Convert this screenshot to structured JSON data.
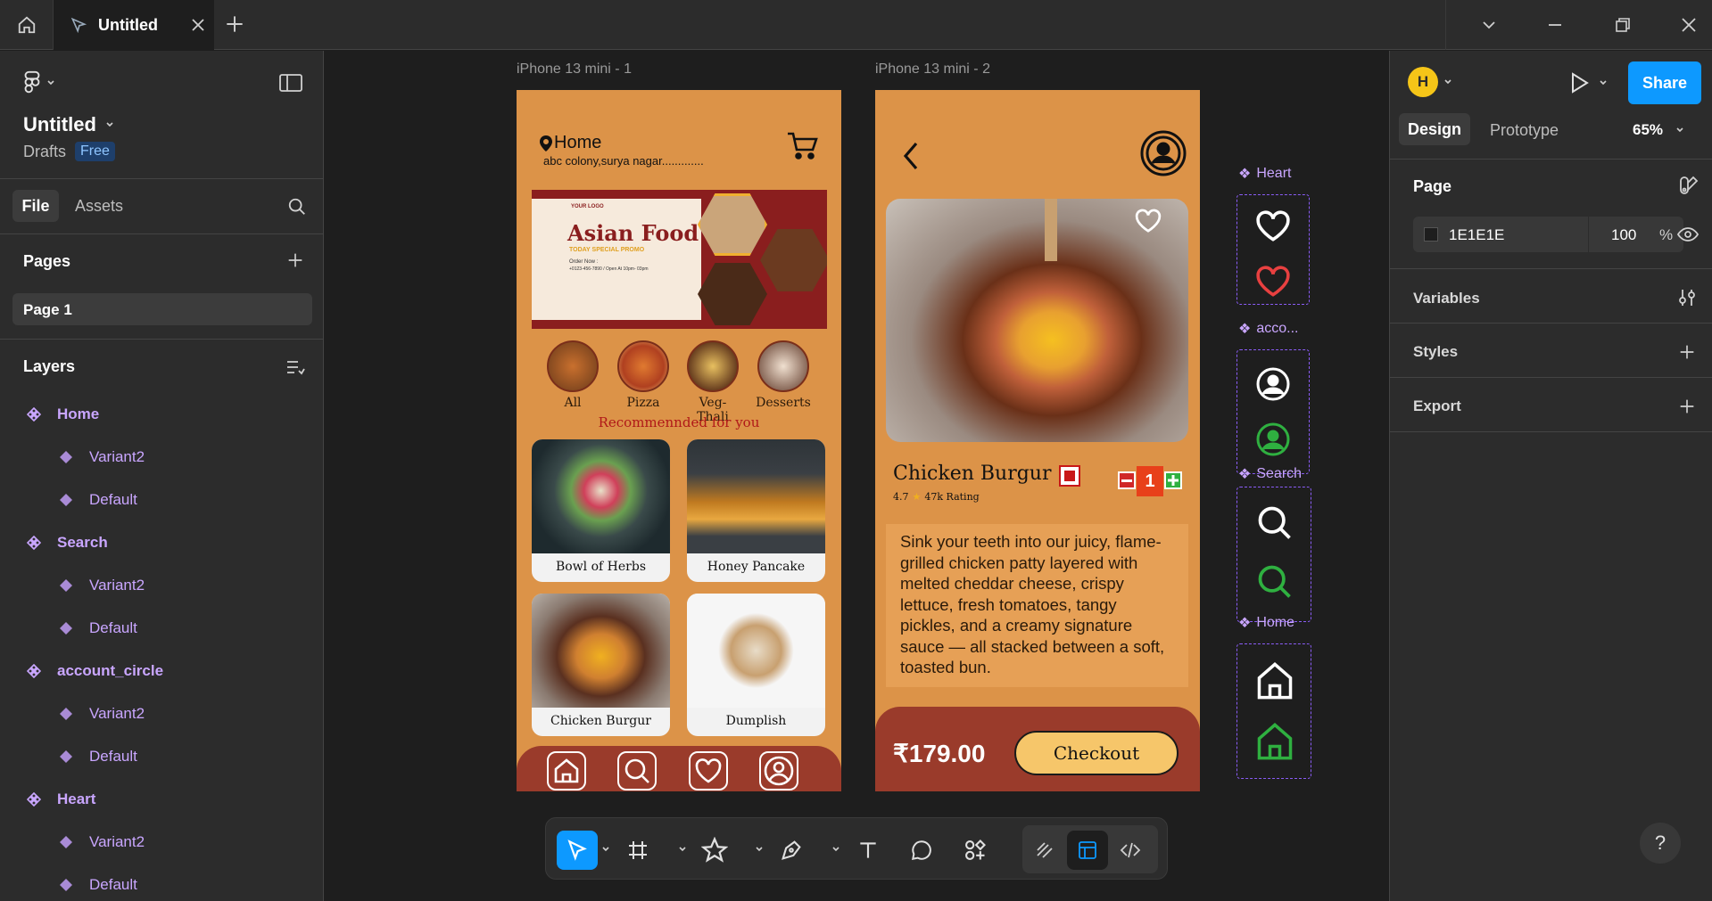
{
  "titlebar": {
    "tab_label": "Untitled"
  },
  "left_panel": {
    "file_name": "Untitled",
    "location": "Drafts",
    "plan_badge": "Free",
    "tabs": [
      {
        "label": "File",
        "active": true
      },
      {
        "label": "Assets",
        "active": false
      }
    ],
    "pages_heading": "Pages",
    "pages": [
      "Page 1"
    ],
    "layers_heading": "Layers",
    "layers": [
      {
        "name": "Home",
        "children": [
          "Variant2",
          "Default"
        ]
      },
      {
        "name": "Search",
        "children": [
          "Variant2",
          "Default"
        ]
      },
      {
        "name": "account_circle",
        "children": [
          "Variant2",
          "Default"
        ]
      },
      {
        "name": "Heart",
        "children": [
          "Variant2",
          "Default"
        ]
      }
    ]
  },
  "canvas": {
    "frame1_label": "iPhone 13 mini - 1",
    "frame2_label": "iPhone 13 mini - 2",
    "home": {
      "location_title": "Home",
      "address": "abc colony,surya nagar.............",
      "banner": {
        "brand": "YOUR LOGO",
        "title": "Asian Food",
        "subtitle": "TODAY SPECIAL PROMO",
        "order_text": "Order Now :",
        "phone": "+0123-456-7890 / Open At 10pm- 03pm"
      },
      "categories": [
        "All",
        "Pizza",
        "Veg-Thali",
        "Desserts"
      ],
      "recommended": "Recommennded for you",
      "items": [
        "Bowl of Herbs",
        "Honey Pancake",
        "Chicken Burgur",
        "Dumplish"
      ]
    },
    "detail": {
      "name": "Chicken Burgur",
      "rating": "4.7",
      "rating_count": "47k Rating",
      "quantity": "1",
      "description": "Sink your teeth into our juicy, flame-grilled chicken patty layered with melted cheddar cheese, crispy lettuce, fresh tomatoes, tangy pickles, and a creamy signature sauce — all stacked between a soft, toasted bun.",
      "price": "₹179.00",
      "checkout_label": "Checkout"
    },
    "components": [
      {
        "label": "Heart"
      },
      {
        "label": "acco..."
      },
      {
        "label": "Search"
      },
      {
        "label": "Home"
      }
    ]
  },
  "right_panel": {
    "avatar_letter": "H",
    "share_label": "Share",
    "tabs": [
      {
        "label": "Design",
        "active": true
      },
      {
        "label": "Prototype",
        "active": false
      }
    ],
    "zoom": "65%",
    "page_heading": "Page",
    "page_color": "1E1E1E",
    "page_opacity": "100",
    "percent_sign": "%",
    "sections": [
      "Variables",
      "Styles",
      "Export"
    ]
  },
  "help_label": "?",
  "colors": {
    "accent": "#0d99ff",
    "component": "#c9a6ff",
    "phone_bg": "#dc9348",
    "nav_bg": "#9a3b2b",
    "checkout_bg": "#f6c66a"
  }
}
